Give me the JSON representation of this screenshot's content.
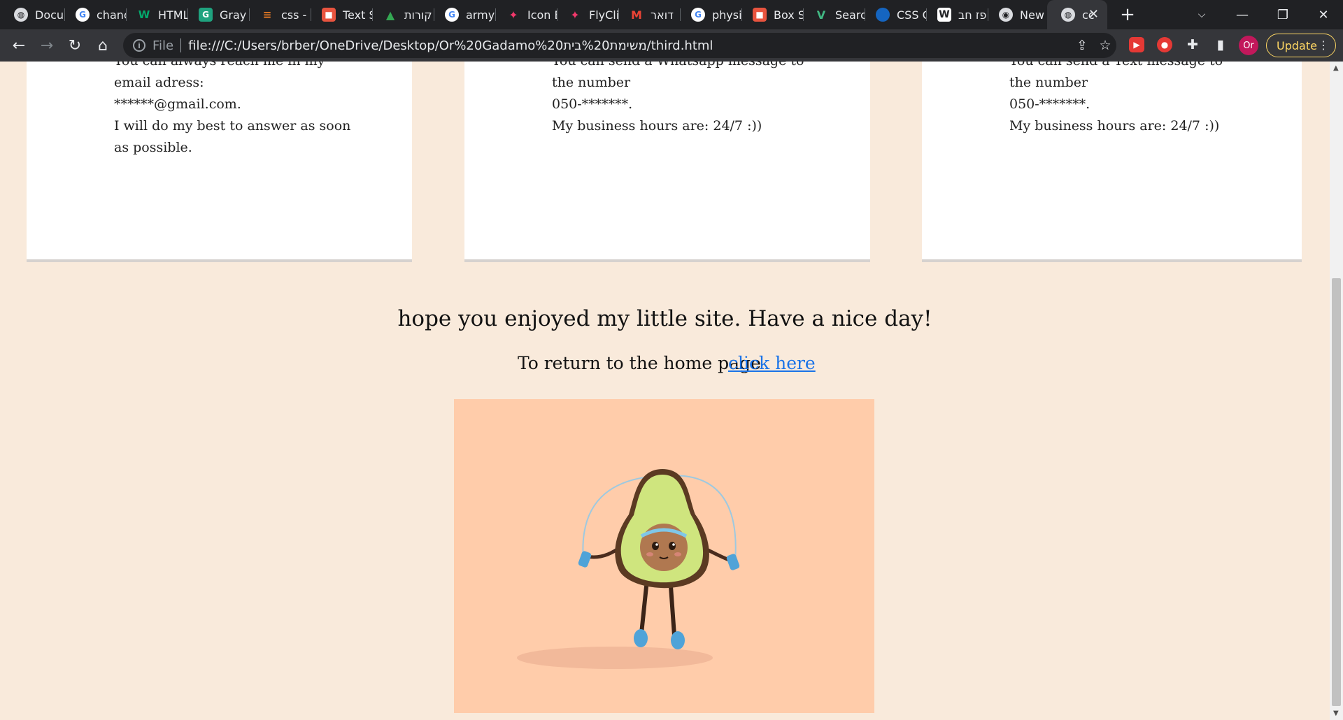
{
  "browser": {
    "tabs": [
      {
        "title": "Docu",
        "icon": "globe-icon",
        "color": "#9aa0a6"
      },
      {
        "title": "chanc",
        "icon": "google-icon",
        "color": "#ffffff"
      },
      {
        "title": "HTML",
        "icon": "w3schools-icon",
        "color": "#04aa6d"
      },
      {
        "title": "Gray",
        "icon": "grayscale-icon",
        "color": "#1fa37f"
      },
      {
        "title": "css -",
        "icon": "stackoverflow-icon",
        "color": "#f48024"
      },
      {
        "title": "Text S",
        "icon": "office-icon",
        "color": "#e8543f"
      },
      {
        "title": "קורות",
        "icon": "drive-icon",
        "color": "#34a853"
      },
      {
        "title": "army",
        "icon": "google-icon",
        "color": "#ffffff"
      },
      {
        "title": "Icon E",
        "icon": "flyclip-icon",
        "color": "#f2386b"
      },
      {
        "title": "FlyCli",
        "icon": "flyclip-icon",
        "color": "#f2386b"
      },
      {
        "title": "דואר",
        "icon": "gmail-icon",
        "color": "#ea4335"
      },
      {
        "title": "physi",
        "icon": "google-icon",
        "color": "#ffffff"
      },
      {
        "title": "Box S",
        "icon": "office-icon",
        "color": "#e8543f"
      },
      {
        "title": "Searc",
        "icon": "vuetify-icon",
        "color": "#41b883"
      },
      {
        "title": "CSS G",
        "icon": "circle-icon",
        "color": "#1565c0"
      },
      {
        "title": "פז חב",
        "icon": "wikipedia-icon",
        "color": "#ffffff"
      },
      {
        "title": "New",
        "icon": "chrome-icon",
        "color": "#dadce0"
      },
      {
        "title": "cc",
        "icon": "globe-icon",
        "color": "#dadce0",
        "active": true
      }
    ],
    "url_scheme": "File",
    "url": "file:///C:/Users/brber/OneDrive/Desktop/Or%20Gadamo%20משימת%20בית/third.html",
    "profile_initials": "Or",
    "update_label": "Update"
  },
  "page": {
    "cards": [
      {
        "lines": [
          "You can always reach me in my",
          "email adress:",
          "******@gmail.com.",
          "I will do my best to answer as soon",
          "as possible."
        ]
      },
      {
        "lines": [
          "You can send a Whatsapp message to",
          "the number",
          "050-*******.",
          "My business hours are: 24/7 :))"
        ]
      },
      {
        "lines": [
          "You can send a Text message to",
          "the number",
          "050-*******.",
          "My business hours are: 24/7 :))"
        ]
      }
    ],
    "closing_message": "hope you enjoyed my little site. Have a nice day!",
    "return_text": "To return to the home page",
    "return_link": "click here"
  }
}
